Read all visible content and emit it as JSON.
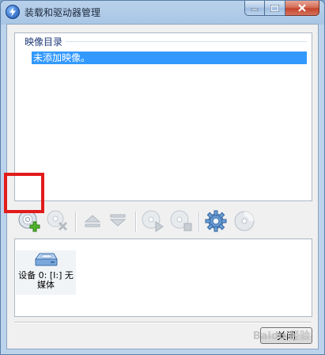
{
  "window": {
    "title": "装载和驱动器管理"
  },
  "image_list": {
    "header": "映像目录",
    "items": [
      "未添加映像。"
    ]
  },
  "toolbar": {
    "icons": [
      "add-image-icon",
      "remove-image-icon",
      "eject-icon",
      "insert-icon",
      "mount-icon",
      "unmount-icon",
      "settings-gear-icon",
      "disc-icon"
    ]
  },
  "devices": [
    {
      "label": "设备 0: [I:] 无媒体"
    }
  ],
  "footer": {
    "close_label": "关闭"
  },
  "watermark": "Baidu 经验",
  "colors": {
    "selection": "#3399ff",
    "highlight_box": "#e21b1b"
  }
}
